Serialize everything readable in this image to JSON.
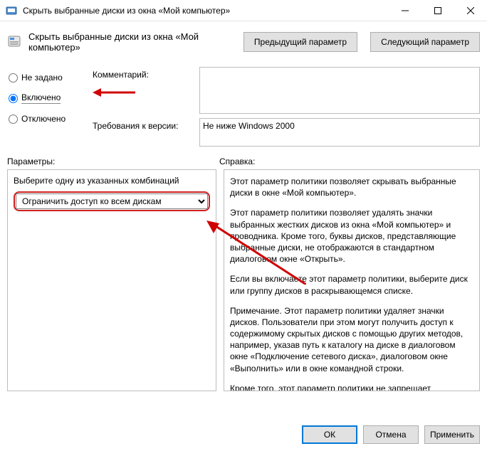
{
  "window": {
    "title": "Скрыть выбранные диски из окна «Мой компьютер»"
  },
  "header": {
    "policy_title": "Скрыть выбранные диски из окна «Мой компьютер»",
    "prev": "Предыдущий параметр",
    "next": "Следующий параметр"
  },
  "radio": {
    "not_configured": "Не задано",
    "enabled": "Включено",
    "disabled": "Отключено",
    "selected": "enabled"
  },
  "comment": {
    "label": "Комментарий:",
    "value": ""
  },
  "requirements": {
    "label": "Требования к версии:",
    "value": "Не ниже Windows 2000"
  },
  "sections": {
    "options": "Параметры:",
    "help": "Справка:"
  },
  "options": {
    "combo_label": "Выберите одну из указанных комбинаций",
    "combo_value": "Ограничить доступ ко всем дискам"
  },
  "help": {
    "p1": "Этот параметр политики позволяет скрывать выбранные диски в окне «Мой компьютер».",
    "p2": "Этот параметр политики позволяет удалять значки выбранных жестких дисков из окна «Мой компьютер» и проводника. Кроме того, буквы дисков, представляющие выбранные диски, не отображаются в стандартном диалоговом окне «Открыть».",
    "p3": "Если вы включаете этот параметр политики, выберите диск или группу дисков в раскрывающемся списке.",
    "p4": "Примечание. Этот параметр политики удаляет значки дисков. Пользователи при этом могут получить доступ к содержимому скрытых дисков с помощью других методов, например, указав путь к каталогу на диске в диалоговом окне «Подключение сетевого диска», диалоговом окне «Выполнить» или в окне командной строки.",
    "p5": "Кроме того, этот параметр политики не запрещает использовать другие программы для доступа к этим дискам"
  },
  "buttons": {
    "ok": "ОК",
    "cancel": "Отмена",
    "apply": "Применить"
  }
}
